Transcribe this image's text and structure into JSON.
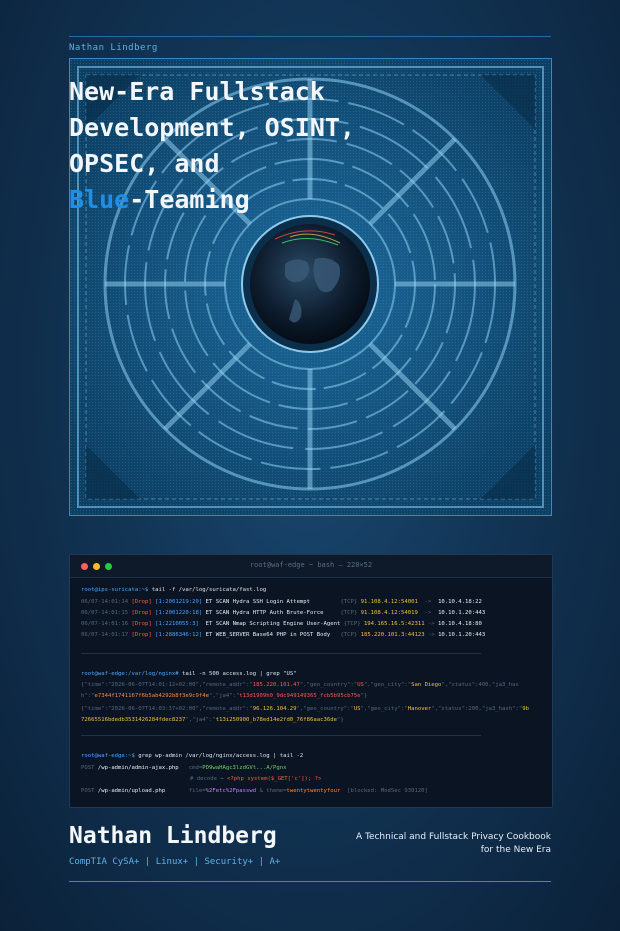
{
  "cover": {
    "author_top": "Nathan Lindberg",
    "title_lines": [
      "New-Era Fullstack",
      "Development, OSINT,",
      "OPSEC, and"
    ],
    "title_blue": "Blue",
    "title_tail": "-Teaming",
    "author": "Nathan Lindberg",
    "certs": "CompTIA CySA+  |  Linux+  |  Security+  |  A+",
    "subtitle_line1": "A Technical and Fullstack Privacy Cookbook",
    "subtitle_line2": "for the New Era"
  },
  "terminal": {
    "title": "root@waf-edge ~ bash — 220×52",
    "prompt1": "root@ips-suricata:~$ ",
    "cmd1": "tail -f /var/log/suricata/fast.log",
    "alerts": [
      {
        "ts": "06/07-14:01:14 ",
        "action": "[Drop]",
        "sid": " [1:2001219:20] ",
        "msg": "ET SCAN Hydra SSH Login Attempt        ",
        "proto": "{TCP} ",
        "src": "91.108.4.12:54001",
        "arrow": "  ->  ",
        "dst": "10.10.4.18:22"
      },
      {
        "ts": "06/07-14:01:15 ",
        "action": "[Drop]",
        "sid": " [1:2001220:18] ",
        "msg": "ET SCAN Hydra HTTP Auth Brute-Force    ",
        "proto": "{TCP} ",
        "src": "91.108.4.12:54019",
        "arrow": "  ->  ",
        "dst": "10.10.1.20:443"
      },
      {
        "ts": "06/07-14:01:16 ",
        "action": "[Drop]",
        "sid": " [1:2210055:3]  ",
        "msg": "ET SCAN Nmap Scripting Engine User-Agent",
        "proto": " {TCP} ",
        "src": "194.165.16.5:42311",
        "arrow": " -> ",
        "dst": "10.10.4.18:80"
      },
      {
        "ts": "06/07-14:01:17 ",
        "action": "[Drop]",
        "sid": " [1:2886346:12] ",
        "msg": "ET WEB_SERVER Base64 PHP in POST Body  ",
        "proto": "{TCP} ",
        "src": "185.220.101.3:44123",
        "arrow": " -> ",
        "dst": "10.10.1.20:443"
      }
    ],
    "prompt2": "root@waf-edge:/var/log/nginx# ",
    "cmd2": "tail -n 500 access.log | grep \"US\"",
    "json1_a": "{\"time\":\"2026-06-07T14:01:12+02:00\",\"remote_addr\":\"",
    "json1_ip": "185.220.101.47",
    "json1_b": "\",\"geo_country\":\"",
    "json1_cc": "US",
    "json1_c": "\",\"geo_city\":\"",
    "json1_city": "San Diego",
    "json1_d": "\",\"status\":400,\"ja3_has",
    "json1_e": "h\":\"",
    "json1_hash": "e7344f1741167f6b5ab4292b8f3e9c9f4e",
    "json1_f": "\",\"ja4\":\"",
    "json1_ja4": "t13d1909h0_9dc949149365_fcb5b95cb75e",
    "json1_g": "\"}",
    "json2_a": "{\"time\":\"2026-06-07T14:03:37+02:00\",\"remote_addr\":\"",
    "json2_ip": "96.126.104.29",
    "json2_b": "\",\"geo_country\":\"",
    "json2_cc": "US",
    "json2_c": "\",\"geo_city\":\"",
    "json2_city": "Hanover",
    "json2_d": "\",\"status\":200,\"ja3_hash\":\"",
    "json2_hash1": "9b",
    "json2_hash2": "72665516bdedb3531426284fdec8237",
    "json2_f": "\",\"ja4\":\"",
    "json2_ja4": "t13i250900_b78ed14e2fd0_76f86aac36de",
    "json2_g": "\"}",
    "prompt3": "root@waf-edge:~$ ",
    "cmd3": "grep wp-admin /var/log/nginx/access.log | tail -2",
    "post1_method": "POST ",
    "post1_path": "/wp-admin/admin-ajax.php",
    "post1_param": "   cmd=",
    "post1_val": "PD9waHAgc3lzdGVt...A/Pgnx",
    "decode_label": "# decode → ",
    "decode_val": "<?php system($_GET['c']); ?>",
    "post2_method": "POST ",
    "post2_path": "/wp-admin/upload.php",
    "post2_param": "       file=",
    "post2_val": "%2Fetc%2Fpasswd",
    "post2_theme": " & theme=",
    "post2_theme_val": "twentytwentyfour",
    "post2_blocked": "  [blocked: ModSec 930120]"
  },
  "colors": {
    "accent": "#1f8fe6",
    "background": "#0d2440",
    "terminal_bg": "#0a1422"
  }
}
